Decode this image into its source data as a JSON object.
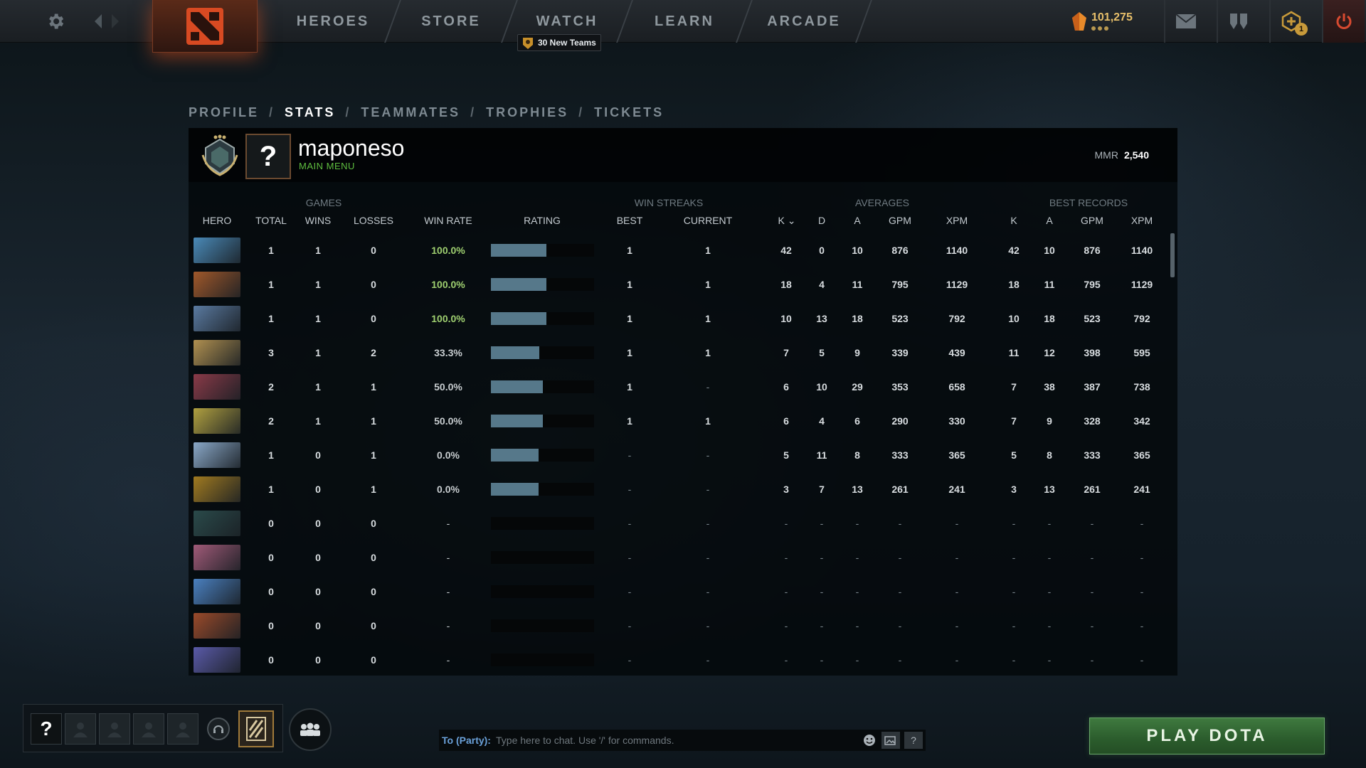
{
  "topbar": {
    "nav": [
      "HEROES",
      "STORE",
      "WATCH",
      "LEARN",
      "ARCADE"
    ],
    "watch_badge": "30 New Teams",
    "currency": "101,275",
    "plus_count": "1"
  },
  "profile": {
    "tabs": [
      "PROFILE",
      "STATS",
      "TEAMMATES",
      "TROPHIES",
      "TICKETS"
    ],
    "active_tab": "STATS",
    "sep": "/",
    "avatar_placeholder": "?",
    "player_name": "maponeso",
    "status": "MAIN MENU",
    "mmr_label": "MMR",
    "mmr_value": "2,540"
  },
  "stats": {
    "groups": {
      "games": "GAMES",
      "win_streaks": "WIN STREAKS",
      "averages": "AVERAGES",
      "best_records": "BEST RECORDS"
    },
    "columns": {
      "hero": "HERO",
      "total": "TOTAL",
      "wins": "WINS",
      "losses": "LOSSES",
      "win_rate": "WIN RATE",
      "rating": "RATING",
      "best": "BEST",
      "current": "CURRENT",
      "k": "K",
      "d": "D",
      "a": "A",
      "gpm": "GPM",
      "xpm": "XPM",
      "best_k": "K",
      "best_a": "A",
      "best_gpm": "GPM",
      "best_xpm": "XPM"
    },
    "rows": [
      {
        "hero_color": "#4a8ab8",
        "total": "1",
        "wins": "1",
        "losses": "0",
        "win_rate": "100.0%",
        "rating": 0.54,
        "best": "1",
        "current": "1",
        "k": "42",
        "d": "0",
        "a": "10",
        "gpm": "876",
        "xpm": "1140",
        "bk": "42",
        "ba": "10",
        "bgpm": "876",
        "bxpm": "1140"
      },
      {
        "hero_color": "#a0582a",
        "total": "1",
        "wins": "1",
        "losses": "0",
        "win_rate": "100.0%",
        "rating": 0.54,
        "best": "1",
        "current": "1",
        "k": "18",
        "d": "4",
        "a": "11",
        "gpm": "795",
        "xpm": "1129",
        "bk": "18",
        "ba": "11",
        "bgpm": "795",
        "bxpm": "1129"
      },
      {
        "hero_color": "#5a7aa0",
        "total": "1",
        "wins": "1",
        "losses": "0",
        "win_rate": "100.0%",
        "rating": 0.54,
        "best": "1",
        "current": "1",
        "k": "10",
        "d": "13",
        "a": "18",
        "gpm": "523",
        "xpm": "792",
        "bk": "10",
        "ba": "18",
        "bgpm": "523",
        "bxpm": "792"
      },
      {
        "hero_color": "#b09050",
        "total": "3",
        "wins": "1",
        "losses": "2",
        "win_rate": "33.3%",
        "rating": 0.47,
        "best": "1",
        "current": "1",
        "k": "7",
        "d": "5",
        "a": "9",
        "gpm": "339",
        "xpm": "439",
        "bk": "11",
        "ba": "12",
        "bgpm": "398",
        "bxpm": "595"
      },
      {
        "hero_color": "#8a3a48",
        "total": "2",
        "wins": "1",
        "losses": "1",
        "win_rate": "50.0%",
        "rating": 0.5,
        "best": "1",
        "current": "-",
        "k": "6",
        "d": "10",
        "a": "29",
        "gpm": "353",
        "xpm": "658",
        "bk": "7",
        "ba": "38",
        "bgpm": "387",
        "bxpm": "738"
      },
      {
        "hero_color": "#b0a040",
        "total": "2",
        "wins": "1",
        "losses": "1",
        "win_rate": "50.0%",
        "rating": 0.5,
        "best": "1",
        "current": "1",
        "k": "6",
        "d": "4",
        "a": "6",
        "gpm": "290",
        "xpm": "330",
        "bk": "7",
        "ba": "9",
        "bgpm": "328",
        "bxpm": "342"
      },
      {
        "hero_color": "#8aa8c8",
        "total": "1",
        "wins": "0",
        "losses": "1",
        "win_rate": "0.0%",
        "rating": 0.46,
        "best": "-",
        "current": "-",
        "k": "5",
        "d": "11",
        "a": "8",
        "gpm": "333",
        "xpm": "365",
        "bk": "5",
        "ba": "8",
        "bgpm": "333",
        "bxpm": "365"
      },
      {
        "hero_color": "#a07a20",
        "total": "1",
        "wins": "0",
        "losses": "1",
        "win_rate": "0.0%",
        "rating": 0.46,
        "best": "-",
        "current": "-",
        "k": "3",
        "d": "7",
        "a": "13",
        "gpm": "261",
        "xpm": "241",
        "bk": "3",
        "ba": "13",
        "bgpm": "261",
        "bxpm": "241"
      },
      {
        "hero_color": "#2a4a4a",
        "total": "0",
        "wins": "0",
        "losses": "0",
        "win_rate": "-",
        "rating": 0,
        "best": "-",
        "current": "-",
        "k": "-",
        "d": "-",
        "a": "-",
        "gpm": "-",
        "xpm": "-",
        "bk": "-",
        "ba": "-",
        "bgpm": "-",
        "bxpm": "-"
      },
      {
        "hero_color": "#a05a78",
        "total": "0",
        "wins": "0",
        "losses": "0",
        "win_rate": "-",
        "rating": 0,
        "best": "-",
        "current": "-",
        "k": "-",
        "d": "-",
        "a": "-",
        "gpm": "-",
        "xpm": "-",
        "bk": "-",
        "ba": "-",
        "bgpm": "-",
        "bxpm": "-"
      },
      {
        "hero_color": "#4a80c0",
        "total": "0",
        "wins": "0",
        "losses": "0",
        "win_rate": "-",
        "rating": 0,
        "best": "-",
        "current": "-",
        "k": "-",
        "d": "-",
        "a": "-",
        "gpm": "-",
        "xpm": "-",
        "bk": "-",
        "ba": "-",
        "bgpm": "-",
        "bxpm": "-"
      },
      {
        "hero_color": "#9a4a2a",
        "total": "0",
        "wins": "0",
        "losses": "0",
        "win_rate": "-",
        "rating": 0,
        "best": "-",
        "current": "-",
        "k": "-",
        "d": "-",
        "a": "-",
        "gpm": "-",
        "xpm": "-",
        "bk": "-",
        "ba": "-",
        "bgpm": "-",
        "bxpm": "-"
      },
      {
        "hero_color": "#5a5aa8",
        "total": "0",
        "wins": "0",
        "losses": "0",
        "win_rate": "-",
        "rating": 0,
        "best": "-",
        "current": "-",
        "k": "-",
        "d": "-",
        "a": "-",
        "gpm": "-",
        "xpm": "-",
        "bk": "-",
        "ba": "-",
        "bgpm": "-",
        "bxpm": "-"
      }
    ]
  },
  "bottom": {
    "party_self": "?",
    "chat_label": "To (Party):",
    "chat_placeholder": "Type here to chat. Use '/' for commands.",
    "chat_help": "?",
    "play_button": "PLAY DOTA"
  },
  "icons": {
    "settings": "gear-icon",
    "back": "arrow-left-icon",
    "forward": "arrow-right-icon",
    "mail": "mail-icon",
    "armory": "armory-icon",
    "plus": "dota-plus-icon",
    "power": "power-icon"
  }
}
